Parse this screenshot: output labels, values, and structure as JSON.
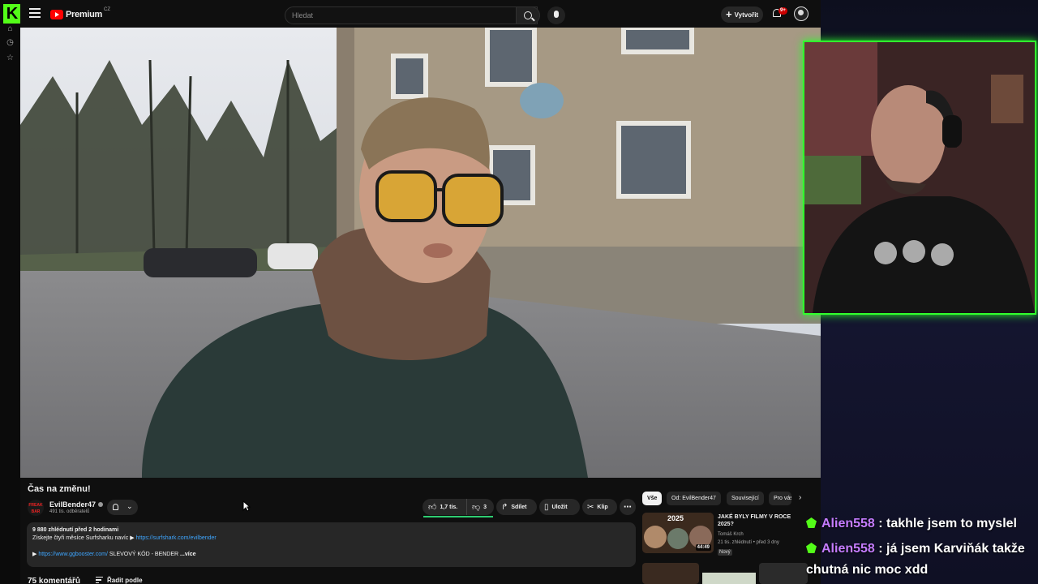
{
  "kick": {
    "logo_letter": "K"
  },
  "youtube": {
    "brand": "Premium",
    "region": "CZ",
    "search_placeholder": "Hledat",
    "create_label": "Vytvořit",
    "notification_count": "9+"
  },
  "video": {
    "title": "Čas na změnu!",
    "channel": {
      "name": "EvilBender47",
      "subscribers": "491 tis. odběratelů",
      "avatar_text": "FREAK BAR"
    },
    "likes": "1,7 tis.",
    "dislikes": "3",
    "share_label": "Sdílet",
    "save_label": "Uložit",
    "clip_label": "Klip",
    "description": {
      "views_line": "9 880 zhlédnutí  před 2 hodinami",
      "line1_text": "Získejte čtyři měsíce Surfsharku navíc ▶ ",
      "line1_link": "https://surfshark.com/evilbender",
      "line2_arrow": "▶ ",
      "line2_link": "https://www.ggbooster.com/",
      "line2_text": " SLEVOVÝ KÓD - BENDER",
      "more": "...více"
    },
    "comments_count": "75 komentářů",
    "sort_label": "Řadit podle"
  },
  "sidebar": {
    "chips": [
      "Vše",
      "Od: EvilBender47",
      "Související",
      "Pro vás"
    ],
    "related": {
      "thumb_year": "2025",
      "duration": "44:49",
      "title": "JAKÉ BYLY FILMY V ROCE 2025?",
      "channel": "Tomáš Krch",
      "meta": "21 tis. zhlédnutí • před 3 dny",
      "badge": "Nový"
    }
  },
  "chat": [
    {
      "user": "Alien558",
      "message": " : takhle jsem to myslel"
    },
    {
      "user": "Alien558",
      "message": " : já jsem Karviňák takže",
      "continuation": "chutná nic moc xdd"
    }
  ],
  "colors": {
    "kick_green": "#53fc18",
    "chat_user": "#c57cff",
    "youtube_red": "#ff0000",
    "link_blue": "#3ea6ff"
  }
}
